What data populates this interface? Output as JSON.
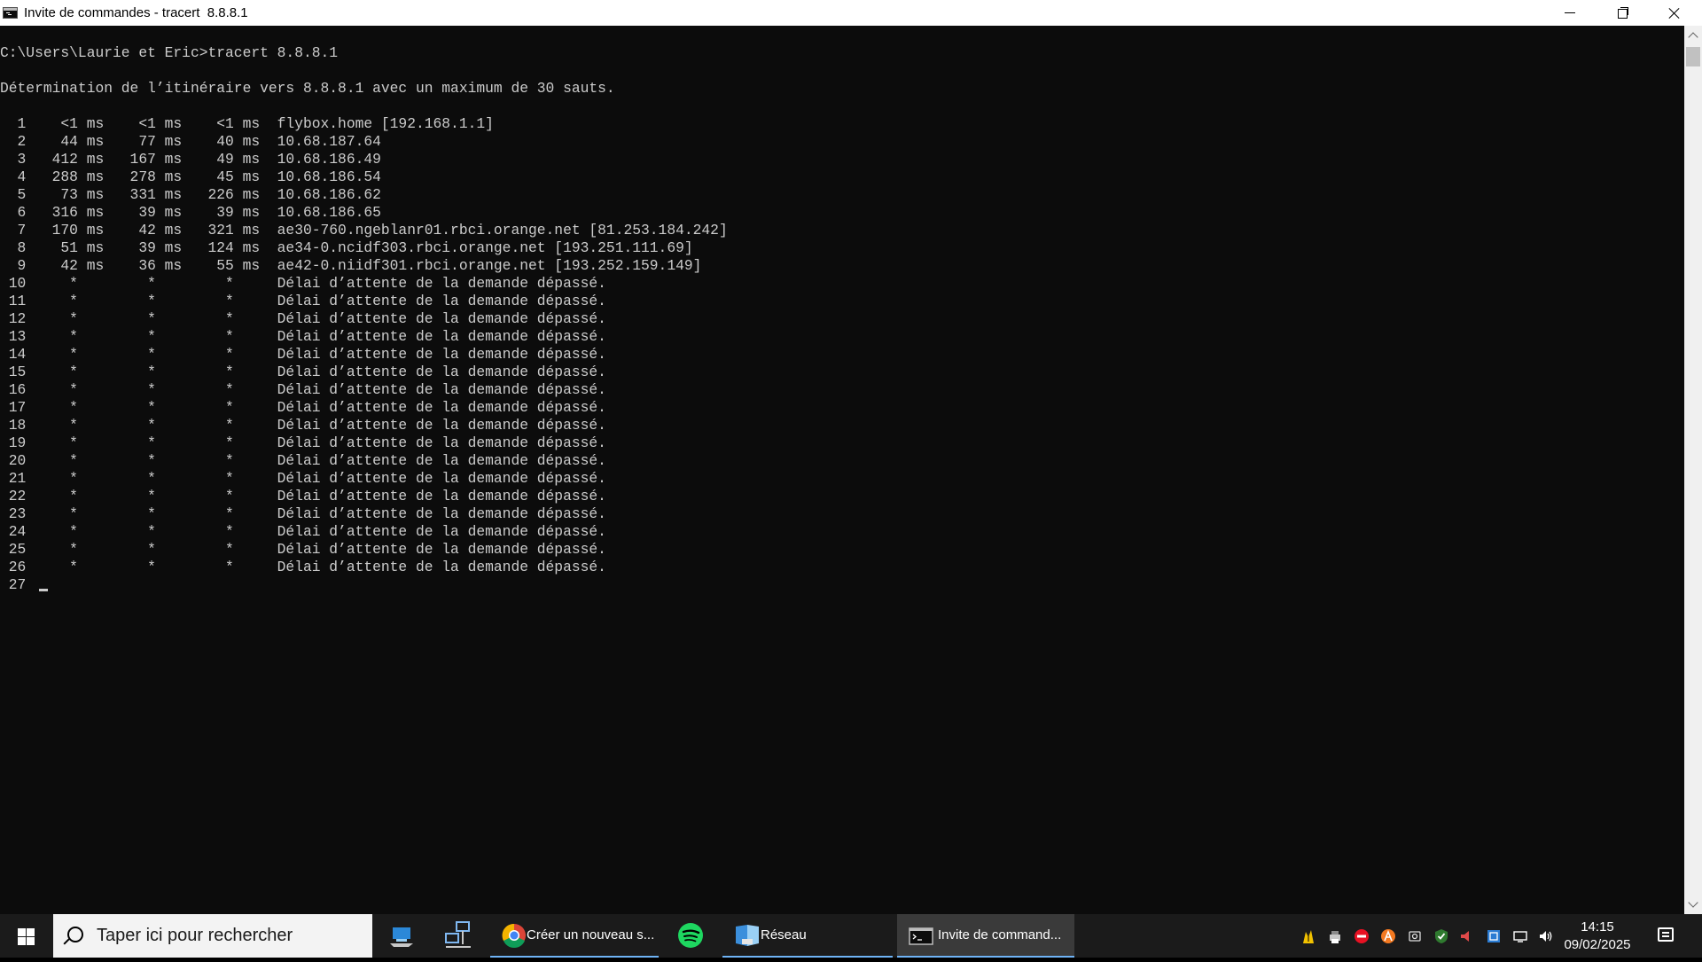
{
  "window": {
    "title": "Invite de commandes - tracert  8.8.8.1"
  },
  "console": {
    "prompt_line": "C:\\Users\\Laurie et Eric>tracert 8.8.8.1",
    "heading": "Détermination de l’itinéraire vers 8.8.8.1 avec un maximum de 30 sauts.",
    "hops": [
      "  1    <1 ms    <1 ms    <1 ms  flybox.home [192.168.1.1]",
      "  2    44 ms    77 ms    40 ms  10.68.187.64",
      "  3   412 ms   167 ms    49 ms  10.68.186.49",
      "  4   288 ms   278 ms    45 ms  10.68.186.54",
      "  5    73 ms   331 ms   226 ms  10.68.186.62",
      "  6   316 ms    39 ms    39 ms  10.68.186.65",
      "  7   170 ms    42 ms   321 ms  ae30-760.ngeblanr01.rbci.orange.net [81.253.184.242]",
      "  8    51 ms    39 ms   124 ms  ae34-0.ncidf303.rbci.orange.net [193.251.111.69]",
      "  9    42 ms    36 ms    55 ms  ae42-0.niidf301.rbci.orange.net [193.252.159.149]",
      " 10     *        *        *     Délai d’attente de la demande dépassé.",
      " 11     *        *        *     Délai d’attente de la demande dépassé.",
      " 12     *        *        *     Délai d’attente de la demande dépassé.",
      " 13     *        *        *     Délai d’attente de la demande dépassé.",
      " 14     *        *        *     Délai d’attente de la demande dépassé.",
      " 15     *        *        *     Délai d’attente de la demande dépassé.",
      " 16     *        *        *     Délai d’attente de la demande dépassé.",
      " 17     *        *        *     Délai d’attente de la demande dépassé.",
      " 18     *        *        *     Délai d’attente de la demande dépassé.",
      " 19     *        *        *     Délai d’attente de la demande dépassé.",
      " 20     *        *        *     Délai d’attente de la demande dépassé.",
      " 21     *        *        *     Délai d’attente de la demande dépassé.",
      " 22     *        *        *     Délai d’attente de la demande dépassé.",
      " 23     *        *        *     Délai d’attente de la demande dépassé.",
      " 24     *        *        *     Délai d’attente de la demande dépassé.",
      " 25     *        *        *     Délai d’attente de la demande dépassé.",
      " 26     *        *        *     Délai d’attente de la demande dépassé.",
      " 27"
    ],
    "text_color": "#cccccc",
    "background": "#0c0c0c"
  },
  "taskbar": {
    "search_placeholder": "Taper ici pour rechercher",
    "tasks": [
      {
        "label": "Créer un nouveau s...",
        "icon": "chrome-icon"
      },
      {
        "label": "",
        "icon": "spotify-icon"
      },
      {
        "label": "Réseau",
        "icon": "network-folder-icon"
      },
      {
        "label": "Invite de command...",
        "icon": "cmd-icon"
      }
    ],
    "clock": {
      "time": "14:15",
      "date": "09/02/2025"
    },
    "accent": "#6fb3f5"
  }
}
